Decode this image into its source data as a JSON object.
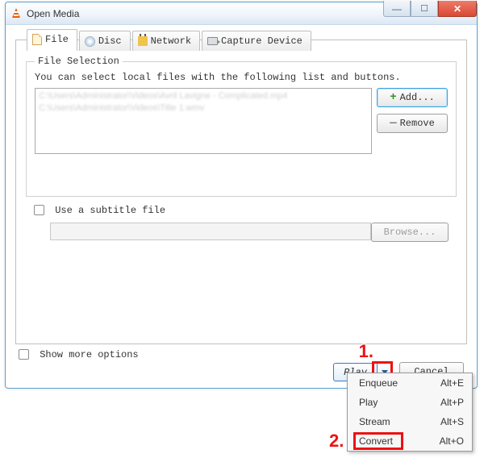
{
  "window": {
    "title": "Open Media"
  },
  "tabs": {
    "file": "File",
    "disc": "Disc",
    "network": "Network",
    "capture": "Capture Device"
  },
  "file_selection": {
    "group_title": "File Selection",
    "description": "You can select local files with the following list and buttons.",
    "files": [
      "C:\\Users\\Administrator\\Videos\\Avril Lavigne - Complicated.mp4",
      "C:\\Users\\Administrator\\Videos\\Title 1.wmv"
    ],
    "add_label": "Add...",
    "remove_label": "Remove"
  },
  "subtitle": {
    "checkbox_label": "Use a subtitle file",
    "value": "",
    "browse_label": "Browse..."
  },
  "show_more_label": "Show more options",
  "footer": {
    "play_label": "Play",
    "cancel_label": "Cancel"
  },
  "dropdown": {
    "items": [
      {
        "label": "Enqueue",
        "shortcut": "Alt+E"
      },
      {
        "label": "Play",
        "shortcut": "Alt+P"
      },
      {
        "label": "Stream",
        "shortcut": "Alt+S"
      },
      {
        "label": "Convert",
        "shortcut": "Alt+O"
      }
    ]
  },
  "annotations": {
    "one": "1.",
    "two": "2."
  },
  "colors": {
    "accent": "#3c7bbf",
    "danger": "#d84a33",
    "highlight": "#e11"
  }
}
